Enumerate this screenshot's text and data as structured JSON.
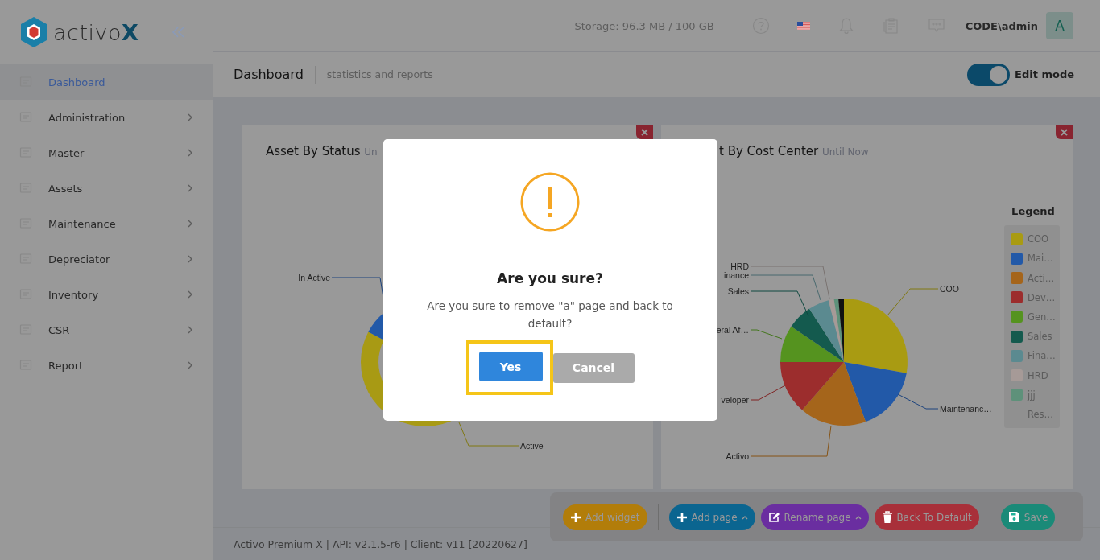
{
  "logo": "activo**X**",
  "header": {
    "storage": "Storage: 96.3 MB / 100 GB",
    "user": "CODE\\admin",
    "avatar": "A"
  },
  "sidebar": {
    "items": [
      {
        "label": "Dashboard",
        "selected": true,
        "has_submenu": false
      },
      {
        "label": "Administration",
        "selected": false,
        "has_submenu": true
      },
      {
        "label": "Master",
        "selected": false,
        "has_submenu": true
      },
      {
        "label": "Assets",
        "selected": false,
        "has_submenu": true
      },
      {
        "label": "Maintenance",
        "selected": false,
        "has_submenu": true
      },
      {
        "label": "Depreciator",
        "selected": false,
        "has_submenu": true
      },
      {
        "label": "Inventory",
        "selected": false,
        "has_submenu": true
      },
      {
        "label": "CSR",
        "selected": false,
        "has_submenu": true
      },
      {
        "label": "Report",
        "selected": false,
        "has_submenu": true
      }
    ]
  },
  "page": {
    "title": "Dashboard",
    "subtitle": "statistics and reports",
    "edit_mode": {
      "label": "Edit mode",
      "on": true
    }
  },
  "widgets": [
    {
      "kind": "donut",
      "title": "Asset By Status",
      "subtitle": "Un",
      "labels": [
        "In Active",
        "Active"
      ]
    },
    {
      "kind": "pie",
      "title": "t By Cost Center",
      "subtitle": "Until Now",
      "labels": [
        "HRD",
        "inance",
        "Sales",
        "eral Af…",
        "veloper",
        "Activo",
        "COO",
        "Maintenanc…"
      ],
      "legend": {
        "title": "Legend",
        "items": [
          {
            "label": "COO",
            "color": "#a99b12"
          },
          {
            "label": "Mai…",
            "color": "#2259a8"
          },
          {
            "label": "Acti…",
            "color": "#a5651b"
          },
          {
            "label": "Dev…",
            "color": "#9c2d2d"
          },
          {
            "label": "Gen…",
            "color": "#55931f"
          },
          {
            "label": "Sales",
            "color": "#145a4e"
          },
          {
            "label": "Fina…",
            "color": "#5b8a90"
          },
          {
            "label": "HRD",
            "color": "#a69a97"
          },
          {
            "label": "jjj",
            "color": "#5e917a"
          },
          {
            "label": "Res…"
          }
        ]
      }
    }
  ],
  "toolbar": [
    {
      "label": "Add widget",
      "kind": "add",
      "color": "#b27d0a",
      "dropdown": false
    },
    {
      "label": "Add page",
      "kind": "add",
      "color": "#0b6590",
      "dropdown": true
    },
    {
      "label": "Rename page",
      "kind": "edit",
      "color": "#6a2ea0",
      "dropdown": true
    },
    {
      "label": "Back To Default",
      "kind": "delete",
      "color": "#a8303a",
      "dropdown": false
    },
    {
      "label": "Save",
      "kind": "save",
      "color": "#1a8a78",
      "dropdown": false
    }
  ],
  "footer": "Activo Premium X | API: v2.1.5-r6 | Client: v11 [20220627]",
  "dialog": {
    "title": "Are you sure?",
    "message": "Are you sure to remove \"a\" page and back to default?",
    "buttons": [
      {
        "label": "Yes",
        "kind": "confirm",
        "highlighted": true
      },
      {
        "label": "Cancel",
        "kind": "cancel",
        "highlighted": false
      }
    ]
  }
}
